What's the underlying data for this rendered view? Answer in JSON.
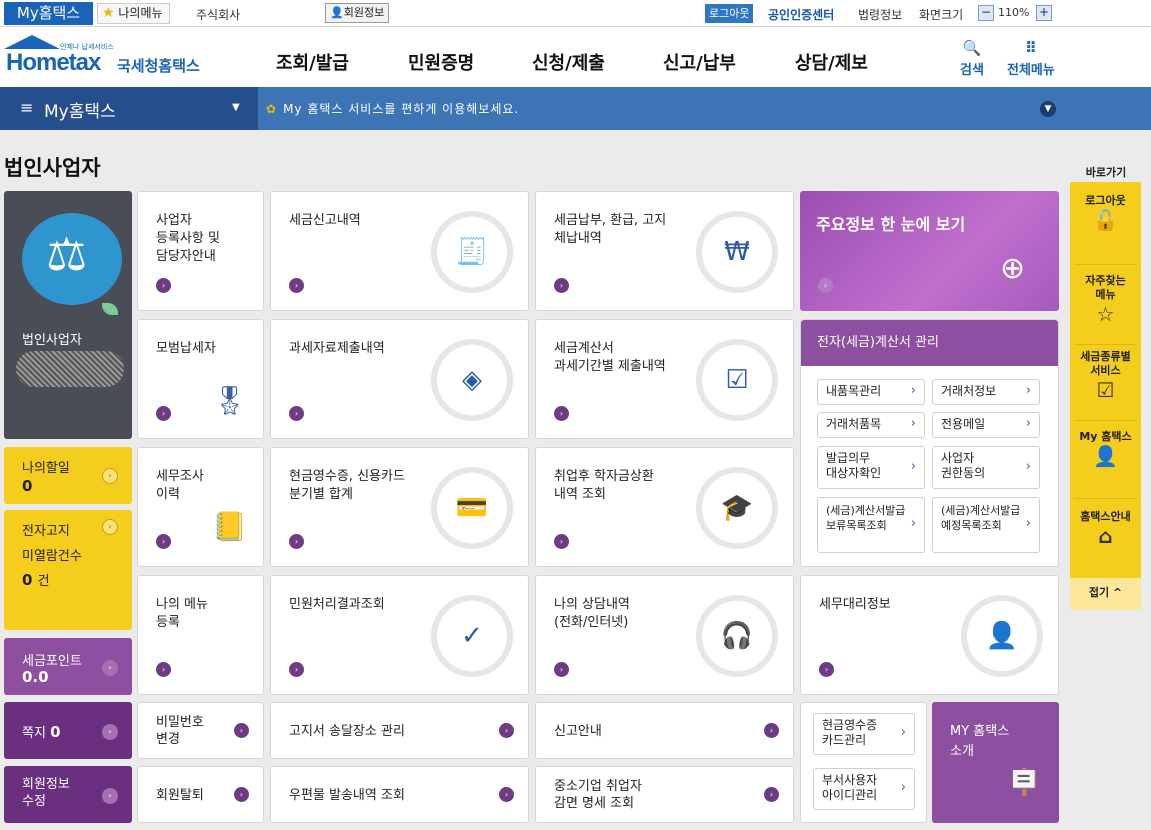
{
  "topbar": {
    "my_hometax": "My홈택스",
    "my_menu": "나의메뉴",
    "company": "주식회사",
    "member_info": "회원정보",
    "logout": "로그아웃",
    "cert_center": "공인인증센터",
    "law_info": "법령정보",
    "screen_size": "화면크기",
    "zoom": "110%"
  },
  "header": {
    "logo_small": "언제나 납세서비스",
    "logo_main": "Hometax",
    "logo_sub": "국세청홈택스",
    "nav": [
      "조회/발급",
      "민원증명",
      "신청/제출",
      "신고/납부",
      "상담/제보"
    ],
    "search": "검색",
    "all_menu": "전체메뉴"
  },
  "bluebar": {
    "selector": "My홈택스",
    "notice": "My 홈택스 서비스를 편하게 이용해보세요."
  },
  "page_title": "법인사업자",
  "profile": {
    "name": "법인사업자"
  },
  "left": {
    "discount_label": "나의할일",
    "discount_value": "0",
    "ebill_label1": "전자고지",
    "ebill_label2": "미열람건수",
    "ebill_value": "0",
    "ebill_unit": "건",
    "points_label": "세금포인트",
    "points_value": "0.0",
    "notes_label": "쪽지",
    "notes_value": "0",
    "member_edit": "회원정보\n수정"
  },
  "cards": {
    "c1": "사업자\n등록사항 및\n담당자안내",
    "c2": "세금신고내역",
    "c3": "세금납부, 환급, 고지\n체납내역",
    "c4": "모범납세자",
    "c5": "과세자료제출내역",
    "c6": "세금계산서\n과세기간별 제출내역",
    "c7": "세무조사\n이력",
    "c8": "현금영수증, 신용카드\n분기별 합계",
    "c9": "취업후 학자금상환\n내역 조회",
    "c10": "나의 메뉴\n등록",
    "c11": "민원처리결과조회",
    "c12": "나의 상담내역\n(전화/인터넷)",
    "c13": "세무대리정보"
  },
  "rows": {
    "r1": "비밀번호\n변경",
    "r2": "고지서 송달장소 관리",
    "r3": "신고안내",
    "r4": "회원탈퇴",
    "r5": "우편물 발송내역 조회",
    "r6": "중소기업 취업자\n감면 명세 조회"
  },
  "purple": {
    "overview": "주요정보 한 눈에 보기",
    "my_intro": "MY 홈택스\n소개"
  },
  "einvoice": {
    "title": "전자(세금)계산서 관리",
    "buttons": [
      "내품목관리",
      "거래처정보",
      "거래처품목",
      "전용메일",
      "발급의무\n대상자확인",
      "사업자\n권한동의",
      "(세금)계산서발급\n보류목록조회",
      "(세금)계산서발급\n예정목록조회"
    ]
  },
  "cashcard": {
    "b1": "현금영수증\n카드관리",
    "b2": "부서사용자\n아이디관리"
  },
  "quick": {
    "title": "바로가기",
    "items": [
      "로그아웃",
      "자주찾는\n메뉴",
      "세금종류별\n서비스",
      "My 홈택스",
      "홈택스안내"
    ],
    "close": "접기 ^"
  },
  "colors": {
    "blue": "#1a64b8",
    "purple": "#8d4fa0",
    "yellow": "#f5cd1c",
    "navbar": "#3d74b5"
  }
}
